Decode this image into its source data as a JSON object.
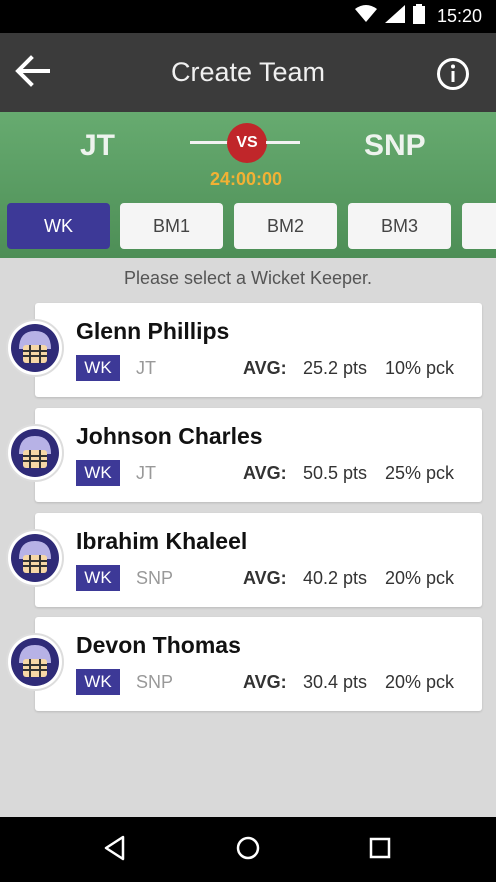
{
  "status_bar": {
    "time": "15:20"
  },
  "app_bar": {
    "title": "Create Team"
  },
  "match": {
    "team_left": "JT",
    "team_right": "SNP",
    "vs_label": "VS",
    "timer": "24:00:00"
  },
  "tabs": [
    {
      "label": "WK",
      "active": true
    },
    {
      "label": "BM1",
      "active": false
    },
    {
      "label": "BM2",
      "active": false
    },
    {
      "label": "BM3",
      "active": false
    }
  ],
  "hint": "Please select a Wicket Keeper.",
  "players": [
    {
      "name": "Glenn Phillips",
      "role": "WK",
      "team": "JT",
      "avg_label": "AVG:",
      "avg": "25.2 pts",
      "pick": "10% pck"
    },
    {
      "name": "Johnson Charles",
      "role": "WK",
      "team": "JT",
      "avg_label": "AVG:",
      "avg": "50.5 pts",
      "pick": "25% pck"
    },
    {
      "name": "Ibrahim Khaleel",
      "role": "WK",
      "team": "SNP",
      "avg_label": "AVG:",
      "avg": "40.2 pts",
      "pick": "20% pck"
    },
    {
      "name": "Devon Thomas",
      "role": "WK",
      "team": "SNP",
      "avg_label": "AVG:",
      "avg": "30.4 pts",
      "pick": "20% pck"
    }
  ],
  "colors": {
    "accent": "#3d3997",
    "header_green": "#5a9c63",
    "vs_red": "#c0262a",
    "timer_orange": "#f2b134"
  }
}
